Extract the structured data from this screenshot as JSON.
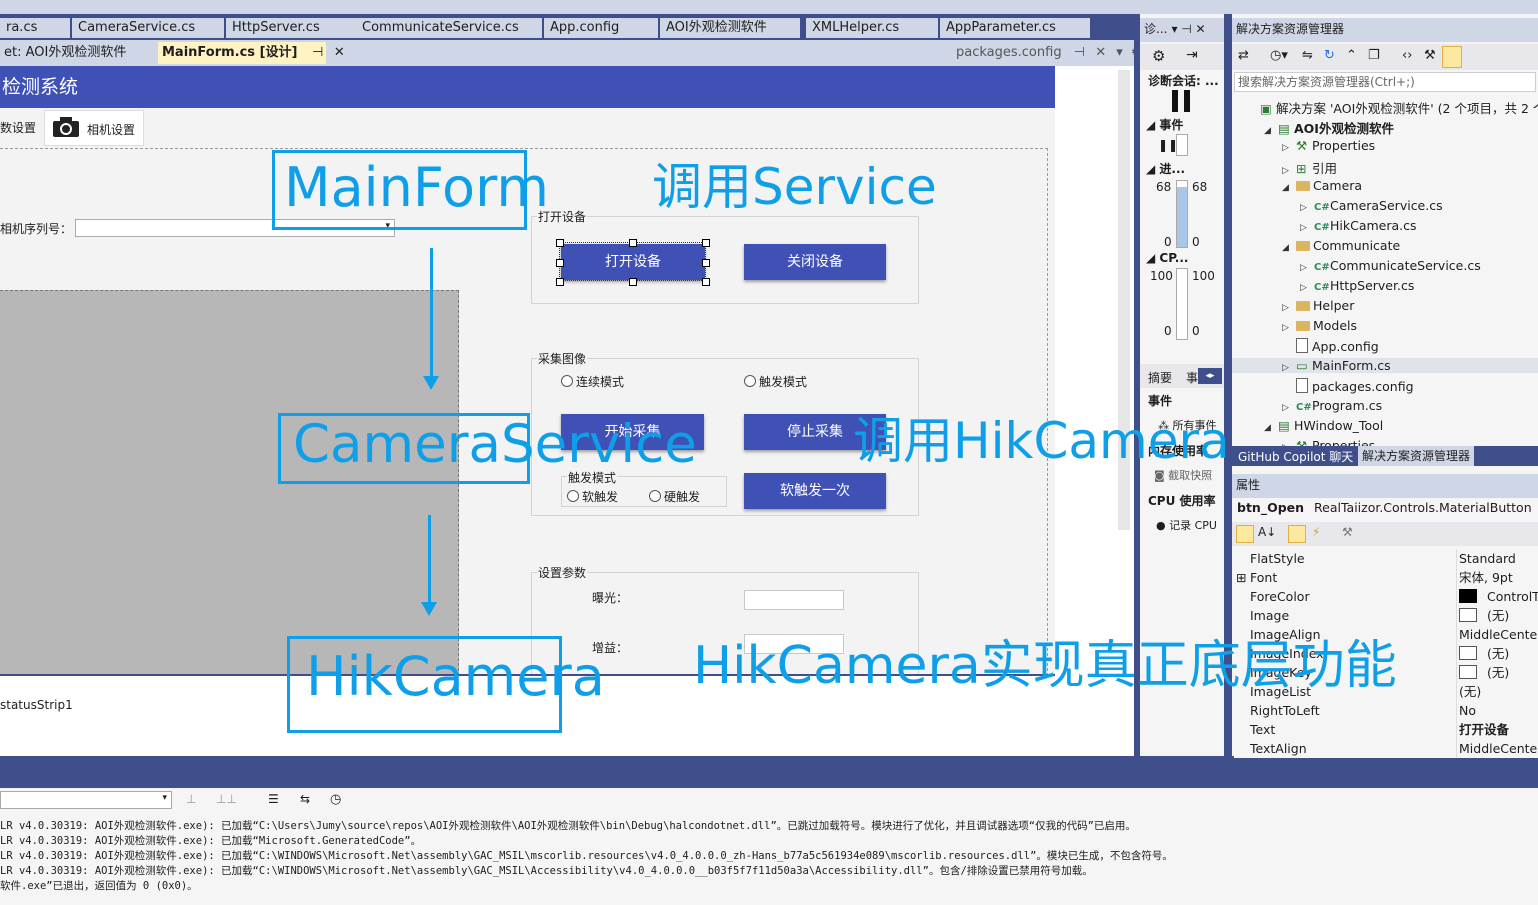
{
  "file_tabs": [
    "ra.cs",
    "CameraService.cs",
    "HttpServer.cs",
    "CommunicateService.cs",
    "App.config",
    "AOI外观检测软件",
    "XMLHelper.cs",
    "AppParameter.cs"
  ],
  "doc_tabs": {
    "project": "et: AOI外观检测软件",
    "active": "MainForm.cs [设计]",
    "pin": "⊣",
    "close": "✕",
    "right": "packages.config"
  },
  "form": {
    "title": "检测系统",
    "tabs": [
      "数设置",
      "相机设置"
    ],
    "camera_serial_label": "相机序列号：",
    "status_strip": "statusStrip1",
    "groups": {
      "open": "打开设备",
      "capture": "采集图像",
      "params": "设置参数",
      "trigger_mode": "触发模式"
    },
    "buttons": {
      "open": "打开设备",
      "close": "关闭设备",
      "start": "开始采集",
      "stop": "停止采集",
      "soft_trigger": "软触发一次"
    },
    "radios": {
      "continuous": "连续模式",
      "trigger": "触发模式",
      "soft": "软触发",
      "hard": "硬触发"
    },
    "param_labels": {
      "exposure": "曝光：",
      "gain": "增益："
    }
  },
  "annotations": {
    "mainform": "MainForm",
    "call_service": "调用Service",
    "camera_service": "CameraService",
    "call_hik": "调用HikCamera",
    "hikcamera": "HikCamera",
    "hik_desc": "HikCamera实现真正底层功能"
  },
  "diag": {
    "header": "诊...",
    "session": "诊断会话: ...",
    "events": "事件",
    "process": "进...",
    "cpu": "CP...",
    "mem_top": "68",
    "mem_top2": "68",
    "mem_bottom": "0",
    "mem_bottom2": "0",
    "cpu_top": "100",
    "cpu_top2": "100",
    "cpu_bottom": "0",
    "cpu_bottom2": "0",
    "tab_summary": "摘要",
    "tab_events": "事",
    "events2": "事件",
    "all_events": "所有事件",
    "memory_usage": "内存使用率",
    "snapshot": "截取快照",
    "cpu_usage": "CPU 使用率",
    "record_cpu": "记录 CPU"
  },
  "solution": {
    "header": "解决方案资源管理器",
    "search_placeholder": "搜索解决方案资源管理器(Ctrl+;)",
    "items": [
      {
        "text": "解决方案 'AOI外观检测软件' (2 个项目，共 2 个)",
        "indent": 0,
        "icon": "solution"
      },
      {
        "text": "AOI外观检测软件",
        "indent": 1,
        "icon": "project",
        "bold": true
      },
      {
        "text": "Properties",
        "indent": 2,
        "icon": "wrench"
      },
      {
        "text": "引用",
        "indent": 2,
        "icon": "ref"
      },
      {
        "text": "Camera",
        "indent": 2,
        "icon": "folder"
      },
      {
        "text": "CameraService.cs",
        "indent": 3,
        "icon": "cs"
      },
      {
        "text": "HikCamera.cs",
        "indent": 3,
        "icon": "cs"
      },
      {
        "text": "Communicate",
        "indent": 2,
        "icon": "folder"
      },
      {
        "text": "CommunicateService.cs",
        "indent": 3,
        "icon": "cs"
      },
      {
        "text": "HttpServer.cs",
        "indent": 3,
        "icon": "cs"
      },
      {
        "text": "Helper",
        "indent": 2,
        "icon": "folder"
      },
      {
        "text": "Models",
        "indent": 2,
        "icon": "folder"
      },
      {
        "text": "App.config",
        "indent": 2,
        "icon": "file"
      },
      {
        "text": "MainForm.cs",
        "indent": 2,
        "icon": "form"
      },
      {
        "text": "packages.config",
        "indent": 2,
        "icon": "file"
      },
      {
        "text": "Program.cs",
        "indent": 2,
        "icon": "cs"
      },
      {
        "text": "HWindow_Tool",
        "indent": 1,
        "icon": "project"
      },
      {
        "text": "Properties",
        "indent": 2,
        "icon": "wrench"
      }
    ],
    "bottom_tabs": [
      "GitHub Copilot 聊天",
      "解决方案资源管理器"
    ]
  },
  "properties": {
    "header": "属性",
    "object_name": "btn_Open",
    "object_type": "RealTaiizor.Controls.MaterialButton",
    "rows": [
      {
        "name": "FlatStyle",
        "value": "Standard"
      },
      {
        "name": "Font",
        "value": "宋体, 9pt",
        "expand": "⊞"
      },
      {
        "name": "ForeColor",
        "value": "ControlText",
        "swatch": "black"
      },
      {
        "name": "Image",
        "value": "(无)",
        "swatch": "white"
      },
      {
        "name": "ImageAlign",
        "value": "MiddleCenter"
      },
      {
        "name": "ImageIndex",
        "value": "(无)",
        "swatch": "white"
      },
      {
        "name": "ImageKey",
        "value": "(无)",
        "swatch": "white"
      },
      {
        "name": "ImageList",
        "value": "(无)"
      },
      {
        "name": "RightToLeft",
        "value": "No"
      },
      {
        "name": "Text",
        "value": "打开设备",
        "bold": true
      },
      {
        "name": "TextAlign",
        "value": "MiddleCenter"
      }
    ]
  },
  "output_lines": [
    "LR v4.0.30319: AOI外观检测软件.exe): 已加载“C:\\Users\\Jumy\\source\\repos\\AOI外观检测软件\\AOI外观检测软件\\bin\\Debug\\halcondotnet.dll”。已跳过加载符号。模块进行了优化，并且调试器选项“仅我的代码”已启用。",
    "LR v4.0.30319: AOI外观检测软件.exe): 已加载“Microsoft.GeneratedCode”。",
    "LR v4.0.30319: AOI外观检测软件.exe): 已加载“C:\\WINDOWS\\Microsoft.Net\\assembly\\GAC_MSIL\\mscorlib.resources\\v4.0_4.0.0.0_zh-Hans_b77a5c561934e089\\mscorlib.resources.dll”。模块已生成，不包含符号。",
    "LR v4.0.30319: AOI外观检测软件.exe): 已加载“C:\\WINDOWS\\Microsoft.Net\\assembly\\GAC_MSIL\\Accessibility\\v4.0_4.0.0.0__b03f5f7f11d50a3a\\Accessibility.dll”。包含/排除设置已禁用符号加载。",
    "软件.exe”已退出，返回值为 0 (0x0)。"
  ],
  "colors": {
    "accent": "#3f51b5",
    "annotation": "#0f9fe8",
    "vs_chrome": "#3f4f8c"
  }
}
